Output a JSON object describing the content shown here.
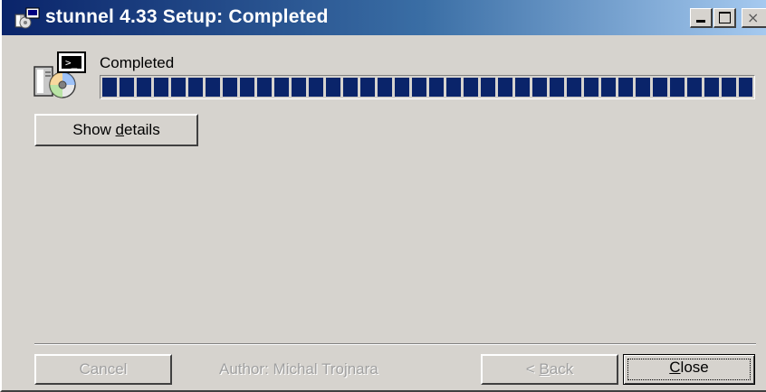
{
  "window": {
    "title": "stunnel 4.33 Setup: Completed",
    "title_icon": "installer-icon",
    "controls": {
      "minimize_icon": "minimize-icon",
      "maximize_icon": "maximize-icon",
      "close_icon": "close-icon",
      "close_glyph": "×"
    }
  },
  "main": {
    "icon": "setup-disk-icon",
    "status_text": "Completed",
    "progress_percent": 100,
    "details_button": {
      "prefix": "Show ",
      "accel": "d",
      "suffix": "etails"
    }
  },
  "footer": {
    "author": "Author: Michal Trojnara",
    "cancel_label": "Cancel",
    "back_button": {
      "prefix": "< ",
      "accel": "B",
      "suffix": "ack"
    },
    "close_button": {
      "prefix": "",
      "accel": "C",
      "suffix": "lose"
    }
  },
  "colors": {
    "title_gradient_start": "#0a246a",
    "title_gradient_end": "#a6caf0",
    "dialog_face": "#d6d3ce",
    "progress_fill": "#0a246a",
    "disabled_text": "#a0a0a0"
  }
}
